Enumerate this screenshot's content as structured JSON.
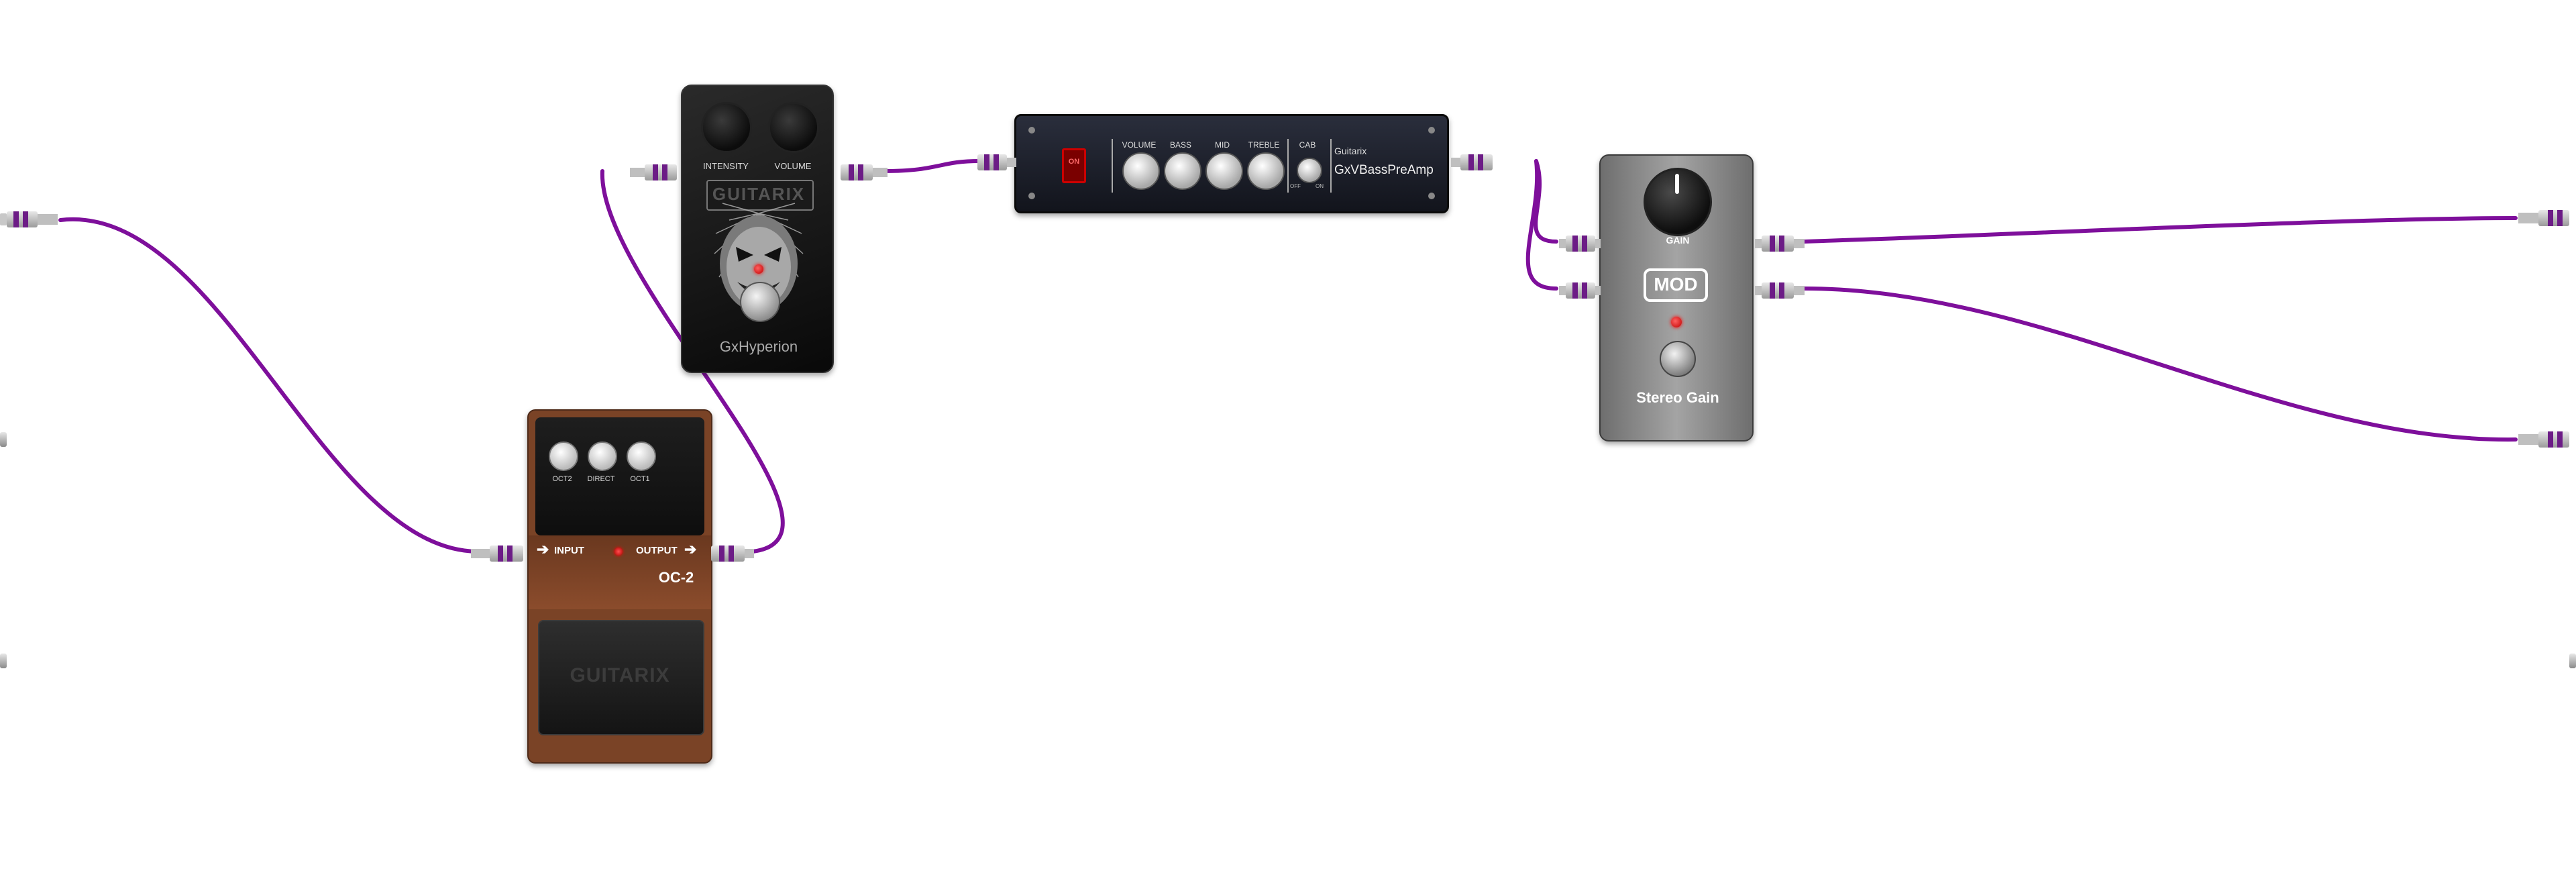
{
  "pedalboard": {
    "pedals": {
      "hyperion": {
        "knob_labels": [
          "INTENSITY",
          "VOLUME"
        ],
        "logo": "GUITARIX",
        "name": "GxHyperion"
      },
      "oc2": {
        "knob_labels": [
          "OCT2",
          "DIRECT",
          "OCT1"
        ],
        "input_label": "INPUT",
        "output_label": "OUTPUT",
        "model": "OC-2",
        "logo": "GUITARIX"
      },
      "bass_preamp": {
        "power": "ON",
        "knob_labels": [
          "VOLUME",
          "BASS",
          "MID",
          "TREBLE",
          "CAB"
        ],
        "cab_switch_labels": [
          "OFF",
          "ON"
        ],
        "brand": "Guitarix",
        "name": "GxVBassPreAmp"
      },
      "stereo_gain": {
        "knob_label": "GAIN",
        "brand": "MOD",
        "name": "Stereo Gain"
      }
    },
    "colors": {
      "cable": "#7e0f9b",
      "led": "#e01010",
      "oc2_body": "#7a4326",
      "preamp_body": "#1c1f2b",
      "gain_body": "#8a8a8a"
    }
  }
}
